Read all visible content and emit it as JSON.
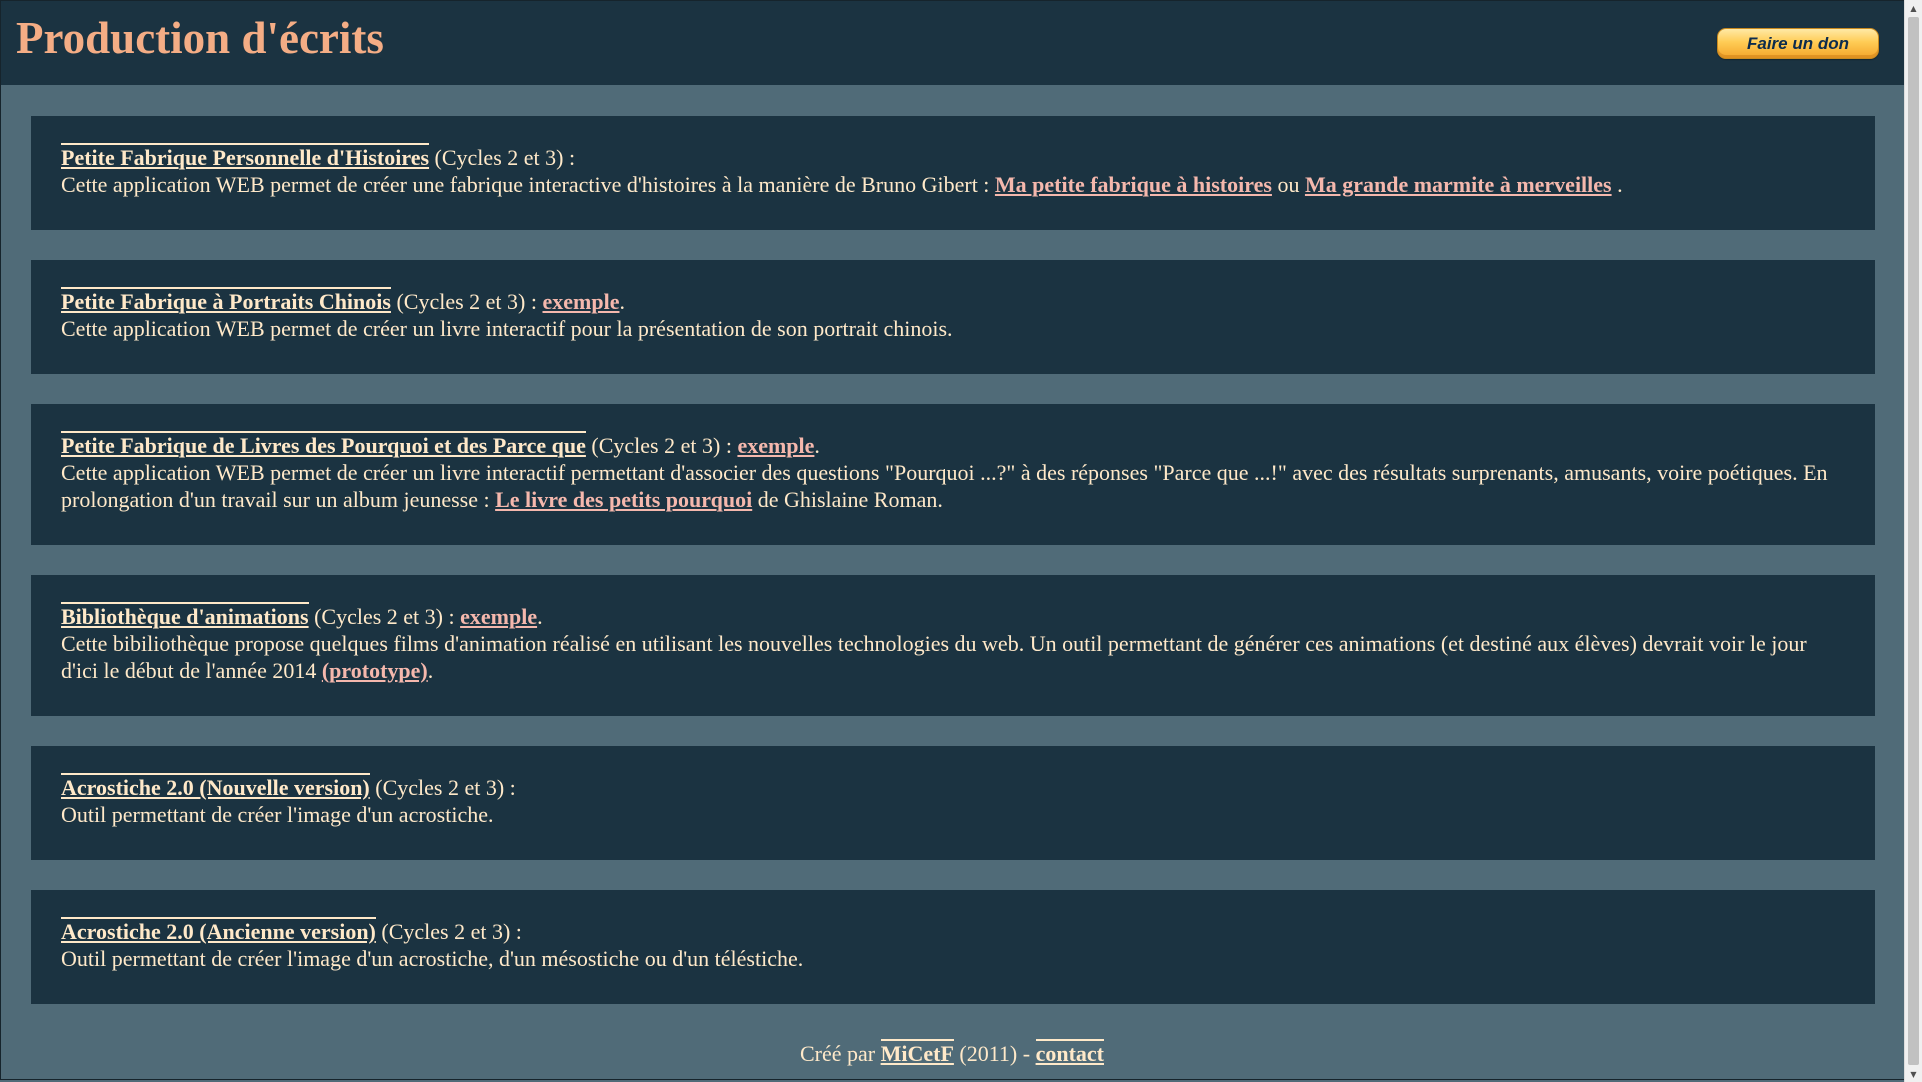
{
  "header": {
    "title": "Production d'écrits",
    "donate_label": "Faire un don"
  },
  "cards": [
    {
      "link": "Petite Fabrique Personnelle d'Histoires",
      "cycles": " (Cycles 2 et 3) :",
      "desc_pre": "Cette application WEB permet de créer une fabrique interactive d'histoires à la manière de Bruno Gibert : ",
      "link2": "Ma petite fabrique à histoires",
      "desc_mid": " ou ",
      "link3": "Ma grande marmite à merveilles",
      "desc_post": " ."
    },
    {
      "link": "Petite Fabrique à Portraits Chinois",
      "cycles": " (Cycles 2 et 3) : ",
      "example": "exemple",
      "after_example": ".",
      "desc": "Cette application WEB permet de créer un livre interactif pour la présentation de son portrait chinois."
    },
    {
      "link": "Petite Fabrique de Livres des Pourquoi et des Parce que",
      "cycles": " (Cycles 2 et 3) : ",
      "example": "exemple",
      "after_example": ".",
      "desc_pre": "Cette application WEB permet de créer un livre interactif permettant d'associer des questions \"Pourquoi ...?\" à des réponses \"Parce que ...!\" avec des résultats surprenants, amusants, voire poétiques. En prolongation d'un travail sur un album jeunesse : ",
      "link2": "Le livre des petits pourquoi",
      "desc_post": " de Ghislaine Roman."
    },
    {
      "link": "Bibliothèque d'animations",
      "cycles": " (Cycles 2 et 3) : ",
      "example": "exemple",
      "after_example": ".",
      "desc_pre": "Cette bibiliothèque propose quelques films d'animation réalisé en utilisant les nouvelles technologies du web. Un outil permettant de générer ces animations (et destiné aux élèves) devrait voir le jour d'ici le début de l'année 2014 ",
      "link2": "(prototype)",
      "desc_post": "."
    },
    {
      "link": "Acrostiche 2.0 (Nouvelle version)",
      "cycles": " (Cycles 2 et 3) :",
      "desc": "Outil permettant de créer l'image d'un acrostiche."
    },
    {
      "link": "Acrostiche 2.0 (Ancienne version)",
      "cycles": " (Cycles 2 et 3) :",
      "desc": "Outil permettant de créer l'image d'un acrostiche, d'un mésostiche ou d'un téléstiche."
    }
  ],
  "footer": {
    "created_by": "Créé par ",
    "author": "MiCetF",
    "year": " (2011) - ",
    "contact": "contact"
  },
  "scrollbar": {
    "up_icon": "▲",
    "down_icon": "▼"
  }
}
